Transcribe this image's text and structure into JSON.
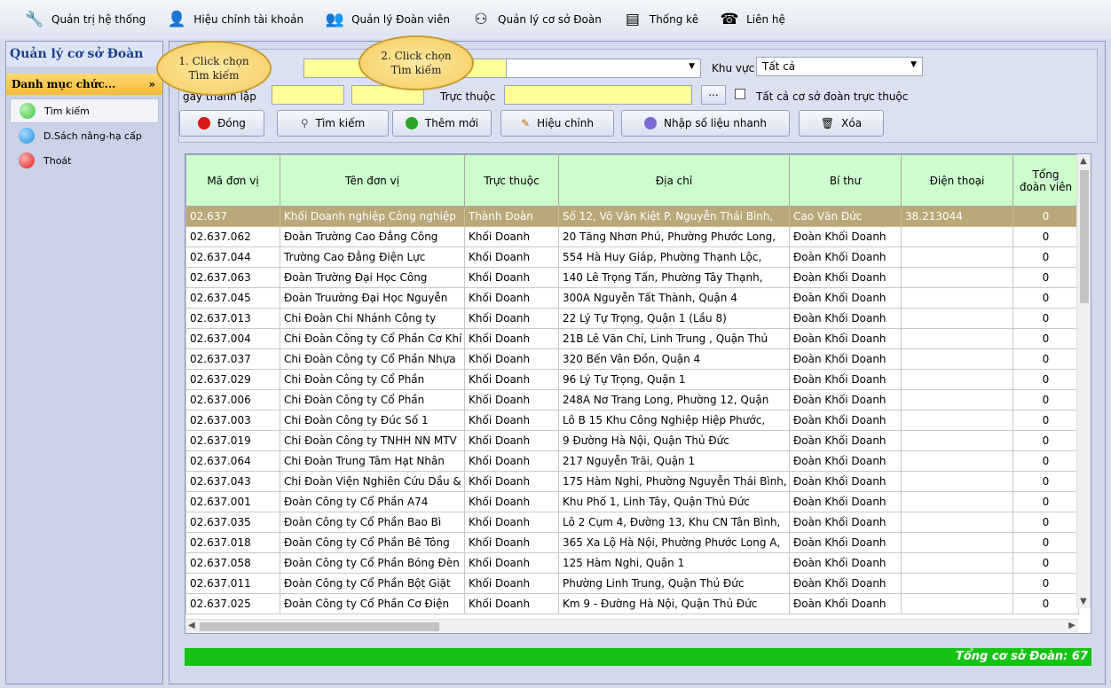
{
  "menu": [
    {
      "label": "Quản trị hệ thống",
      "icon": "tools-icon"
    },
    {
      "label": "Hiệu chỉnh tài khoản",
      "icon": "user-edit-icon"
    },
    {
      "label": "Quản lý Đoàn viên",
      "icon": "members-icon"
    },
    {
      "label": "Quản lý cơ sở Đoàn",
      "icon": "organization-icon"
    },
    {
      "label": "Thống kê",
      "icon": "statistics-icon"
    },
    {
      "label": "Liên hệ",
      "icon": "contact-icon"
    }
  ],
  "sidebar": {
    "title": "Quản lý cơ sở Đoàn",
    "section": "Danh mục chức...",
    "items": [
      {
        "label": "Tìm kiếm",
        "color": "#3fbf3f"
      },
      {
        "label": "D.Sách nâng-hạ cấp",
        "color": "#1e8fe0"
      },
      {
        "label": "Thoát",
        "color": "#e01b1b"
      }
    ]
  },
  "filter": {
    "khu_vuc_label": "Khu vực",
    "khu_vuc_value": "Tất cả",
    "ngay_label": "gày thành lập",
    "truc_thuoc_label": "Trực thuộc",
    "browse_label": "...",
    "all_checkbox_label": "Tất cả cơ sở đoàn trực thuộc"
  },
  "buttons": {
    "close": "Đóng",
    "search": "Tìm kiếm",
    "add": "Thêm mới",
    "edit": "Hiệu chỉnh",
    "quick_input": "Nhập số liệu nhanh",
    "delete": "Xóa"
  },
  "callouts": {
    "first": "1. Click chọn Tìm kiếm",
    "second": "2. Click chọn Tìm kiếm"
  },
  "table": {
    "headers": [
      "Mã đơn vị",
      "Tên đơn vị",
      "Trực thuộc",
      "Địa chỉ",
      "Bí thư",
      "Điện thoại",
      "Tổng đoàn viên"
    ],
    "rows": [
      [
        "02.637",
        "Khối Doanh nghiệp Công nghiệp",
        "Thành Đoàn",
        "Số 12, Võ Văn Kiệt P. Nguyễn Thái Bình,",
        "Cao Văn Đức",
        "38.213044",
        "0"
      ],
      [
        "02.637.062",
        "Đoàn Trường Cao Đẳng Công",
        "Khối Doanh",
        "20 Tăng Nhơn Phú, Phường Phước Long,",
        "Đoàn Khối Doanh",
        "",
        "0"
      ],
      [
        "02.637.044",
        "Trường Cao Đẳng Điện Lực",
        "Khối Doanh",
        "554 Hà Huy Giáp, Phường Thạnh Lộc,",
        "Đoàn Khối Doanh",
        "",
        "0"
      ],
      [
        "02.637.063",
        "Đoàn Trường Đại Học Công",
        "Khối Doanh",
        "140 Lê Trọng Tấn, Phường Tây Thạnh,",
        "Đoàn Khối Doanh",
        "",
        "0"
      ],
      [
        "02.637.045",
        "Đoàn Truường Đại Học Nguyễn",
        "Khối Doanh",
        "300A Nguyễn Tất Thành, Quận 4",
        "Đoàn Khối Doanh",
        "",
        "0"
      ],
      [
        "02.637.013",
        "Chi Đoàn Chi Nhánh Công ty",
        "Khối Doanh",
        "22 Lý Tự Trọng, Quận 1 (Lầu 8)",
        "Đoàn Khối Doanh",
        "",
        "0"
      ],
      [
        "02.637.004",
        "Chi Đoàn Công ty Cổ Phần Cơ Khí",
        "Khối Doanh",
        "21B Lê Văn Chí, Linh Trung , Quận Thủ",
        "Đoàn Khối Doanh",
        "",
        "0"
      ],
      [
        "02.637.037",
        "Chi Đoàn Công ty Cổ Phần Nhựa",
        "Khối Doanh",
        "320 Bến Vân Đồn, Quận 4",
        "Đoàn Khối Doanh",
        "",
        "0"
      ],
      [
        "02.637.029",
        "Chi Đoàn Công ty Cổ Phần",
        "Khối Doanh",
        "96 Lý Tự Trọng, Quận 1",
        "Đoàn Khối Doanh",
        "",
        "0"
      ],
      [
        "02.637.006",
        "Chi Đoàn Công ty Cổ Phần",
        "Khối Doanh",
        "248A Nơ Trang Long, Phường 12, Quận",
        "Đoàn Khối Doanh",
        "",
        "0"
      ],
      [
        "02.637.003",
        "Chi Đoàn Công ty Đúc Số 1",
        "Khối Doanh",
        "Lô B 15 Khu Công Nghiệp Hiệp Phước,",
        "Đoàn Khối Doanh",
        "",
        "0"
      ],
      [
        "02.637.019",
        "Chi Đoàn Công ty TNHH NN MTV",
        "Khối Doanh",
        "9 Đường Hà Nội, Quận Thủ Đức",
        "Đoàn Khối Doanh",
        "",
        "0"
      ],
      [
        "02.637.064",
        "Chi Đoàn Trung Tâm Hạt Nhân",
        "Khối Doanh",
        "217 Nguyễn Trãi, Quận 1",
        "Đoàn Khối Doanh",
        "",
        "0"
      ],
      [
        "02.637.043",
        "Chi Đoàn Viện Nghiên Cứu Dầu &",
        "Khối Doanh",
        "175 Hàm Nghi, Phường Nguyễn Thái Bình,",
        "Đoàn Khối Doanh",
        "",
        "0"
      ],
      [
        "02.637.001",
        "Đoàn Công ty Cổ Phần A74",
        "Khối Doanh",
        "Khu Phố 1, Linh Tây, Quận Thủ Đức",
        "Đoàn Khối Doanh",
        "",
        "0"
      ],
      [
        "02.637.035",
        "Đoàn Công ty Cổ Phần Bao Bì",
        "Khối Doanh",
        "Lô 2 Cụm 4, Đường 13, Khu CN Tân Bình,",
        "Đoàn Khối Doanh",
        "",
        "0"
      ],
      [
        "02.637.018",
        "Đoàn Công ty Cổ Phần Bê Tông",
        "Khối Doanh",
        "365 Xa Lộ Hà Nội, Phường Phước Long A,",
        "Đoàn Khối Doanh",
        "",
        "0"
      ],
      [
        "02.637.058",
        "Đoàn Công ty Cổ Phần Bóng Đèn",
        "Khối Doanh",
        "125 Hàm Nghi, Quận 1",
        "Đoàn Khối Doanh",
        "",
        "0"
      ],
      [
        "02.637.011",
        "Đoàn Công ty Cổ Phần Bột Giặt",
        "Khối Doanh",
        "Phường Linh Trung, Quận Thủ Đức",
        "Đoàn Khối Doanh",
        "",
        "0"
      ],
      [
        "02.637.025",
        "Đoàn Công ty Cổ Phần Cơ Điện",
        "Khối Doanh",
        "Km 9 - Đường Hà Nội, Quận Thủ Đức",
        "Đoàn Khối Doanh",
        "",
        "0"
      ]
    ]
  },
  "total_label": "Tổng cơ sở Đoàn: 67"
}
